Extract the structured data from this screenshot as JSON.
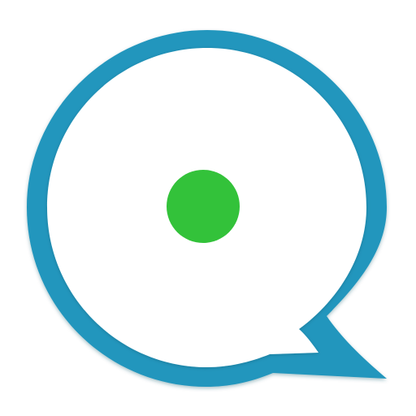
{
  "icon": {
    "name": "chat-bubble-icon",
    "colors": {
      "background": "#ffffff",
      "ring": "#2196bd",
      "ring_shadow": "#1a6f8c",
      "inner_fill": "#ffffff",
      "dot": "#33c23a"
    }
  }
}
